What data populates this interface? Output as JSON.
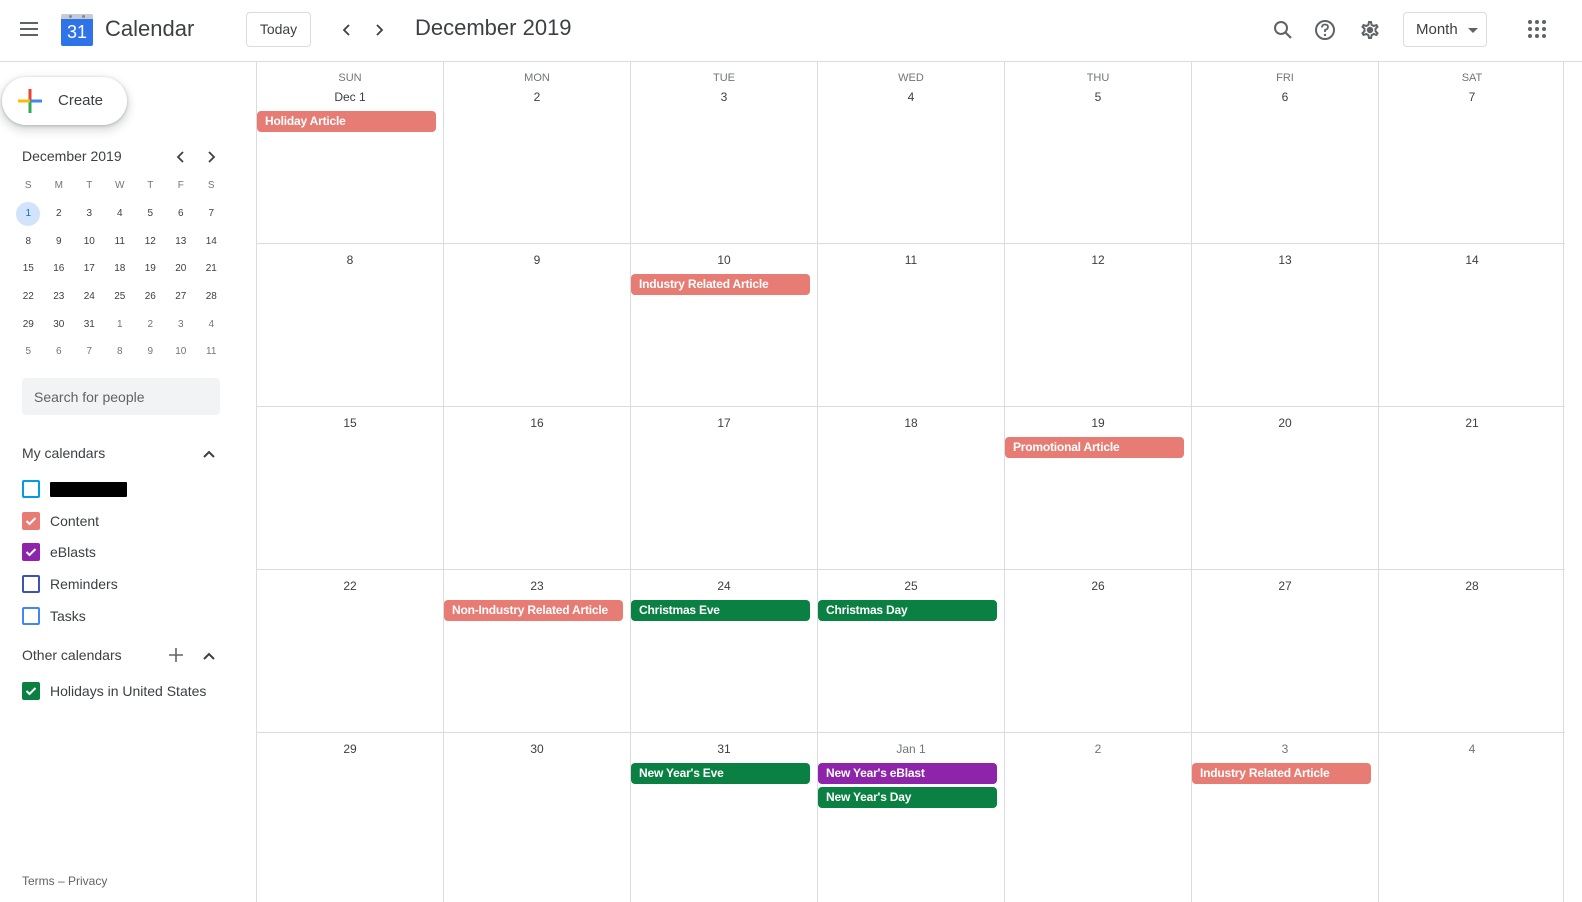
{
  "header": {
    "menu_icon": "hamburger-menu-icon",
    "app_title": "Calendar",
    "logo_day": "31",
    "today_label": "Today",
    "prev_icon": "chevron-left-icon",
    "next_icon": "chevron-right-icon",
    "period_title": "December 2019",
    "view_selected": "Month",
    "icons": [
      "search-icon",
      "help-icon",
      "settings-icon",
      "apps-grid-icon"
    ]
  },
  "sidebar": {
    "create_label": "Create",
    "mini_calendar": {
      "title": "December 2019",
      "weekdays": [
        "S",
        "M",
        "T",
        "W",
        "T",
        "F",
        "S"
      ],
      "weeks": [
        [
          {
            "d": "1",
            "today": true
          },
          {
            "d": "2"
          },
          {
            "d": "3"
          },
          {
            "d": "4"
          },
          {
            "d": "5"
          },
          {
            "d": "6"
          },
          {
            "d": "7"
          }
        ],
        [
          {
            "d": "8"
          },
          {
            "d": "9"
          },
          {
            "d": "10"
          },
          {
            "d": "11"
          },
          {
            "d": "12"
          },
          {
            "d": "13"
          },
          {
            "d": "14"
          }
        ],
        [
          {
            "d": "15"
          },
          {
            "d": "16"
          },
          {
            "d": "17"
          },
          {
            "d": "18"
          },
          {
            "d": "19"
          },
          {
            "d": "20"
          },
          {
            "d": "21"
          }
        ],
        [
          {
            "d": "22"
          },
          {
            "d": "23"
          },
          {
            "d": "24"
          },
          {
            "d": "25"
          },
          {
            "d": "26"
          },
          {
            "d": "27"
          },
          {
            "d": "28"
          }
        ],
        [
          {
            "d": "29"
          },
          {
            "d": "30"
          },
          {
            "d": "31"
          },
          {
            "d": "1",
            "other": true
          },
          {
            "d": "2",
            "other": true
          },
          {
            "d": "3",
            "other": true
          },
          {
            "d": "4",
            "other": true
          }
        ],
        [
          {
            "d": "5",
            "other": true
          },
          {
            "d": "6",
            "other": true
          },
          {
            "d": "7",
            "other": true
          },
          {
            "d": "8",
            "other": true
          },
          {
            "d": "9",
            "other": true
          },
          {
            "d": "10",
            "other": true
          },
          {
            "d": "11",
            "other": true
          }
        ]
      ]
    },
    "people_search_placeholder": "Search for people",
    "my_calendars_title": "My calendars",
    "my_calendars": [
      {
        "name": "",
        "redacted": true,
        "checked": false,
        "color": "#039be5"
      },
      {
        "name": "Content",
        "checked": true,
        "color": "#e67c73"
      },
      {
        "name": "eBlasts",
        "checked": true,
        "color": "#8e24aa"
      },
      {
        "name": "Reminders",
        "checked": false,
        "color": "#3f51b5"
      },
      {
        "name": "Tasks",
        "checked": false,
        "color": "#4285f4"
      }
    ],
    "other_calendars_title": "Other calendars",
    "other_calendars": [
      {
        "name": "Holidays in United States",
        "checked": true,
        "color": "#0b8043"
      }
    ],
    "footer": {
      "terms": "Terms",
      "separator": " – ",
      "privacy": "Privacy"
    }
  },
  "colors": {
    "content": "#e67c73",
    "holiday": "#0b8043",
    "eblast": "#8e24aa",
    "accent": "#1a73e8"
  },
  "month_grid": {
    "weekdays": [
      "SUN",
      "MON",
      "TUE",
      "WED",
      "THU",
      "FRI",
      "SAT"
    ],
    "weeks": [
      [
        {
          "label": "Dec 1",
          "events": [
            {
              "title": "Holiday Article",
              "calendar": "content"
            }
          ]
        },
        {
          "label": "2",
          "events": []
        },
        {
          "label": "3",
          "events": []
        },
        {
          "label": "4",
          "events": []
        },
        {
          "label": "5",
          "events": []
        },
        {
          "label": "6",
          "events": []
        },
        {
          "label": "7",
          "events": []
        }
      ],
      [
        {
          "label": "8",
          "events": []
        },
        {
          "label": "9",
          "events": []
        },
        {
          "label": "10",
          "events": [
            {
              "title": "Industry Related Article",
              "calendar": "content"
            }
          ]
        },
        {
          "label": "11",
          "events": []
        },
        {
          "label": "12",
          "events": []
        },
        {
          "label": "13",
          "events": []
        },
        {
          "label": "14",
          "events": []
        }
      ],
      [
        {
          "label": "15",
          "events": []
        },
        {
          "label": "16",
          "events": []
        },
        {
          "label": "17",
          "events": []
        },
        {
          "label": "18",
          "events": []
        },
        {
          "label": "19",
          "events": [
            {
              "title": "Promotional Article",
              "calendar": "content"
            }
          ]
        },
        {
          "label": "20",
          "events": []
        },
        {
          "label": "21",
          "events": []
        }
      ],
      [
        {
          "label": "22",
          "events": []
        },
        {
          "label": "23",
          "events": [
            {
              "title": "Non-Industry Related Article",
              "calendar": "content"
            }
          ]
        },
        {
          "label": "24",
          "events": [
            {
              "title": "Christmas Eve",
              "calendar": "holiday"
            }
          ]
        },
        {
          "label": "25",
          "events": [
            {
              "title": "Christmas Day",
              "calendar": "holiday"
            }
          ]
        },
        {
          "label": "26",
          "events": []
        },
        {
          "label": "27",
          "events": []
        },
        {
          "label": "28",
          "events": []
        }
      ],
      [
        {
          "label": "29",
          "events": []
        },
        {
          "label": "30",
          "events": []
        },
        {
          "label": "31",
          "events": [
            {
              "title": "New Year's Eve",
              "calendar": "holiday"
            }
          ]
        },
        {
          "label": "Jan 1",
          "other": true,
          "events": [
            {
              "title": "New Year's eBlast",
              "calendar": "eblast"
            },
            {
              "title": "New Year's Day",
              "calendar": "holiday"
            }
          ]
        },
        {
          "label": "2",
          "other": true,
          "events": []
        },
        {
          "label": "3",
          "other": true,
          "events": [
            {
              "title": "Industry Related Article",
              "calendar": "content"
            }
          ]
        },
        {
          "label": "4",
          "other": true,
          "events": []
        }
      ]
    ]
  }
}
